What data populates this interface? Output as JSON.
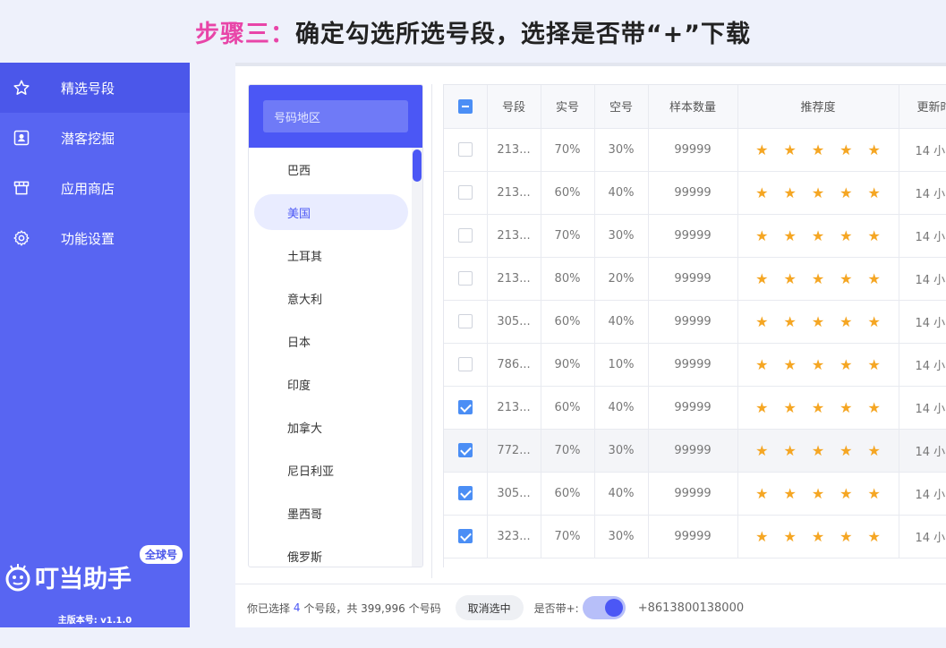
{
  "headline": {
    "step": "步骤三：",
    "text": "确定勾选所选号段，选择是否带“+”下载"
  },
  "sidebar": {
    "items": [
      {
        "label": "精选号段",
        "icon": "star-icon",
        "active": true
      },
      {
        "label": "潜客挖掘",
        "icon": "contact-card-icon",
        "active": false
      },
      {
        "label": "应用商店",
        "icon": "store-icon",
        "active": false
      },
      {
        "label": "功能设置",
        "icon": "gear-icon",
        "active": false
      }
    ],
    "brand": "叮当助手",
    "badge": "全球号",
    "version": "主版本号: v1.1.0"
  },
  "country_panel": {
    "search_placeholder": "号码地区",
    "countries": [
      "巴西",
      "美国",
      "土耳其",
      "意大利",
      "日本",
      "印度",
      "加拿大",
      "尼日利亚",
      "墨西哥",
      "俄罗斯"
    ],
    "selected": "美国"
  },
  "table": {
    "headers": [
      "号段",
      "实号",
      "空号",
      "样本数量",
      "推荐度",
      "更新时"
    ],
    "rows": [
      {
        "checked": false,
        "segment": "213...",
        "real": "70%",
        "empty": "30%",
        "samples": "99999",
        "rating": 5,
        "updated": "14 小"
      },
      {
        "checked": false,
        "segment": "213...",
        "real": "60%",
        "empty": "40%",
        "samples": "99999",
        "rating": 5,
        "updated": "14 小"
      },
      {
        "checked": false,
        "segment": "213...",
        "real": "70%",
        "empty": "30%",
        "samples": "99999",
        "rating": 5,
        "updated": "14 小"
      },
      {
        "checked": false,
        "segment": "213...",
        "real": "80%",
        "empty": "20%",
        "samples": "99999",
        "rating": 5,
        "updated": "14 小"
      },
      {
        "checked": false,
        "segment": "305...",
        "real": "60%",
        "empty": "40%",
        "samples": "99999",
        "rating": 5,
        "updated": "14 小"
      },
      {
        "checked": false,
        "segment": "786...",
        "real": "90%",
        "empty": "10%",
        "samples": "99999",
        "rating": 5,
        "updated": "14 小"
      },
      {
        "checked": true,
        "segment": "213...",
        "real": "60%",
        "empty": "40%",
        "samples": "99999",
        "rating": 5,
        "updated": "14 小"
      },
      {
        "checked": true,
        "segment": "772...",
        "real": "70%",
        "empty": "30%",
        "samples": "99999",
        "rating": 5,
        "updated": "14 小",
        "highlight": true
      },
      {
        "checked": true,
        "segment": "305...",
        "real": "60%",
        "empty": "40%",
        "samples": "99999",
        "rating": 5,
        "updated": "14 小"
      },
      {
        "checked": true,
        "segment": "323...",
        "real": "70%",
        "empty": "30%",
        "samples": "99999",
        "rating": 5,
        "updated": "14 小"
      }
    ]
  },
  "footer": {
    "prefix": "你已选择",
    "selected_count": "4",
    "middle": "个号段，共 399,996 个号码",
    "cancel_label": "取消选中",
    "plus_label": "是否带+:",
    "plus_enabled": true,
    "phone_example": "+8613800138000"
  },
  "colors": {
    "accent": "#4b57f5",
    "sidebar": "#5865f2",
    "step": "#e845a8",
    "star": "#f5a623"
  }
}
